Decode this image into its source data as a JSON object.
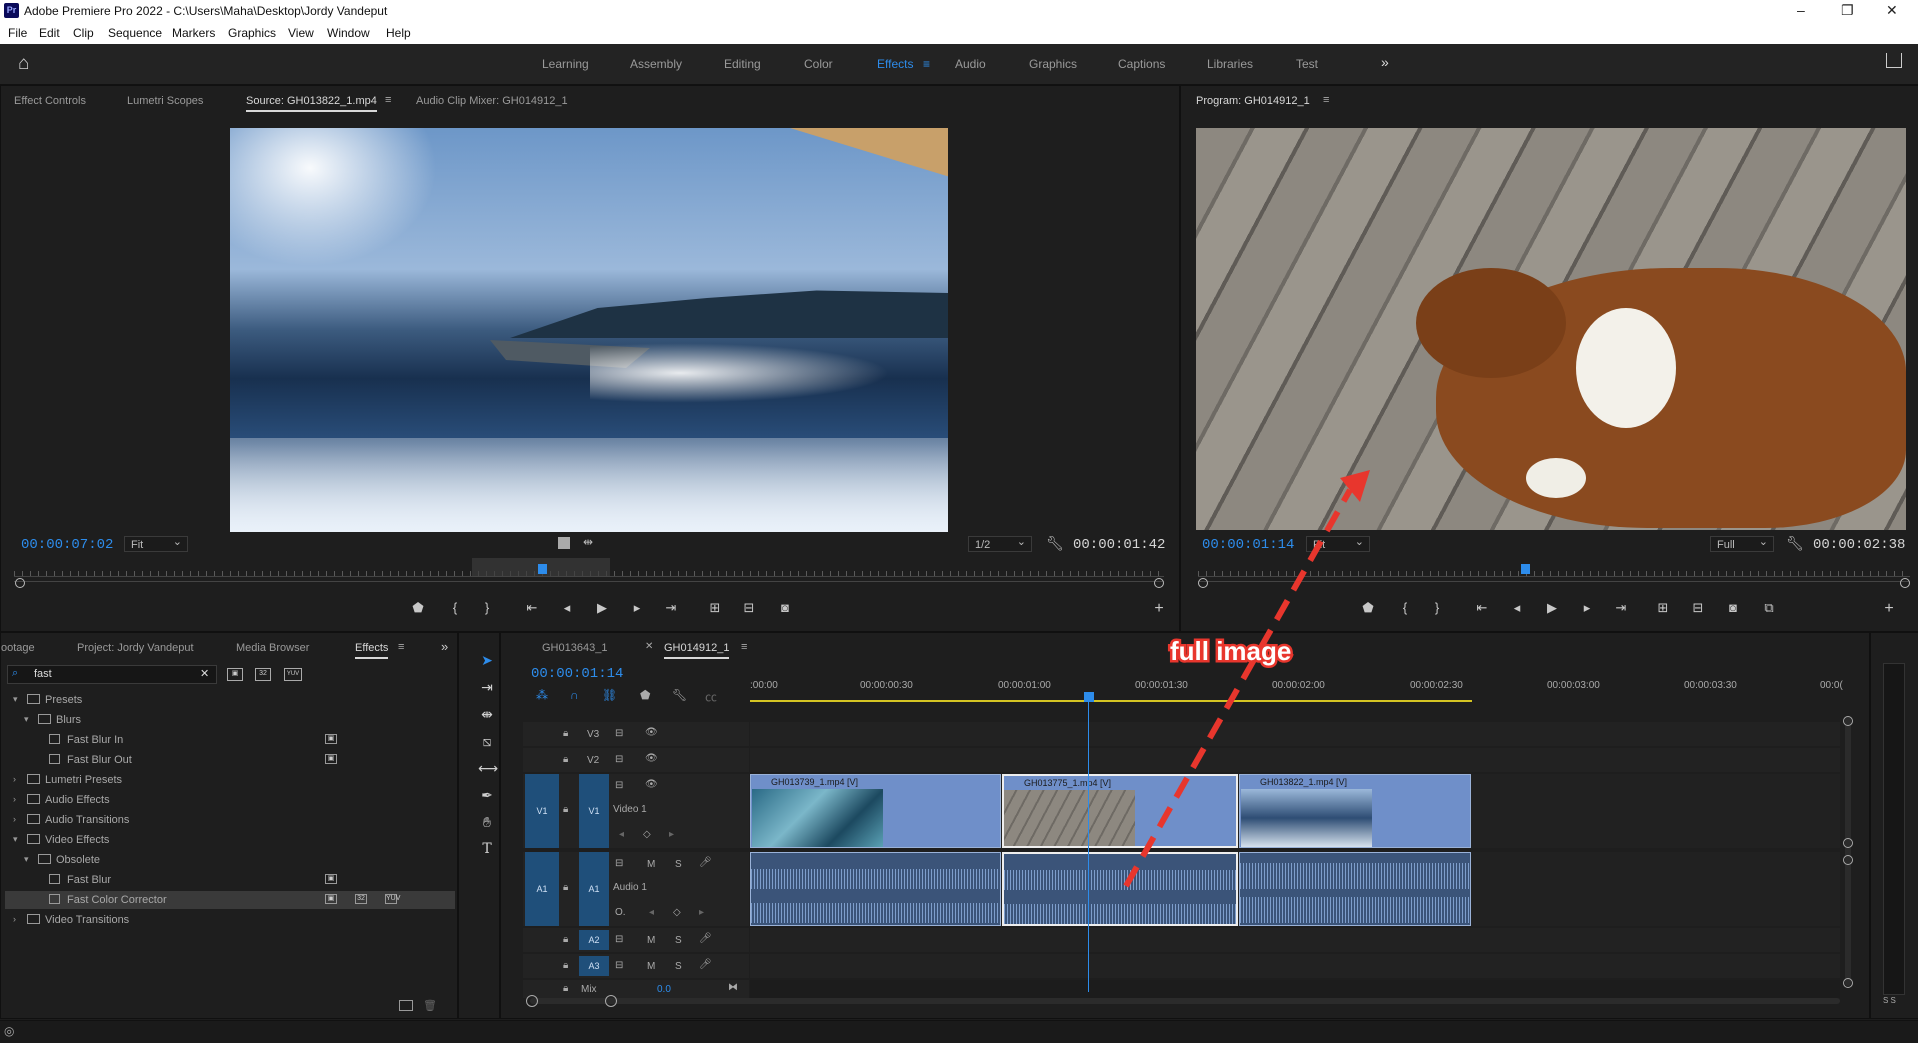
{
  "titlebar": {
    "logo": "Pr",
    "title": "Adobe Premiere Pro 2022 - C:\\Users\\Maha\\Desktop\\Jordy Vandeput",
    "minimize": "–",
    "restore": "❐",
    "close": "✕"
  },
  "menu": [
    "File",
    "Edit",
    "Clip",
    "Sequence",
    "Markers",
    "Graphics",
    "View",
    "Window",
    "Help"
  ],
  "workspaces": {
    "items": [
      "Learning",
      "Assembly",
      "Editing",
      "Color",
      "Effects",
      "Audio",
      "Graphics",
      "Captions",
      "Libraries",
      "Test"
    ],
    "active": "Effects",
    "more": "»"
  },
  "source_panel": {
    "tabs": [
      "Effect Controls",
      "Lumetri Scopes",
      "Source: GH013822_1.mp4",
      "Audio Clip Mixer: GH014912_1"
    ],
    "active_tab": "Source: GH013822_1.mp4",
    "timecode_in": "00:00:07:02",
    "fit": "Fit",
    "resolution": "1/2",
    "duration": "00:00:01:42"
  },
  "program_panel": {
    "tab": "Program: GH014912_1",
    "timecode": "00:00:01:14",
    "fit": "Fit",
    "resolution": "Full",
    "duration": "00:00:02:38"
  },
  "project_panel": {
    "tabs": [
      "ootage",
      "Project: Jordy Vandeput",
      "Media Browser",
      "Effects"
    ],
    "active_tab": "Effects",
    "search_value": "fast",
    "tree": [
      {
        "label": "Presets",
        "level": 0,
        "arrow": "▾",
        "folder": true
      },
      {
        "label": "Blurs",
        "level": 1,
        "arrow": "▾",
        "folder": true
      },
      {
        "label": "Fast Blur In",
        "level": 2,
        "arrow": "",
        "folder": false,
        "badges": [
          "▣"
        ]
      },
      {
        "label": "Fast Blur Out",
        "level": 2,
        "arrow": "",
        "folder": false,
        "badges": [
          "▣"
        ]
      },
      {
        "label": "Lumetri Presets",
        "level": 0,
        "arrow": "›",
        "folder": true
      },
      {
        "label": "Audio Effects",
        "level": 0,
        "arrow": "›",
        "folder": true
      },
      {
        "label": "Audio Transitions",
        "level": 0,
        "arrow": "›",
        "folder": true
      },
      {
        "label": "Video Effects",
        "level": 0,
        "arrow": "▾",
        "folder": true
      },
      {
        "label": "Obsolete",
        "level": 1,
        "arrow": "▾",
        "folder": true
      },
      {
        "label": "Fast Blur",
        "level": 2,
        "arrow": "",
        "folder": false,
        "badges": [
          "▣"
        ]
      },
      {
        "label": "Fast Color Corrector",
        "level": 2,
        "arrow": "",
        "folder": false,
        "badges": [
          "▣",
          "32",
          "YUV"
        ],
        "selected": true
      },
      {
        "label": "Video Transitions",
        "level": 0,
        "arrow": "›",
        "folder": true
      }
    ]
  },
  "timeline": {
    "tabs": [
      "GH013643_1",
      "GH014912_1"
    ],
    "active_tab": "GH014912_1",
    "timecode": "00:00:01:14",
    "ruler": [
      ":00:00",
      "00:00:00:30",
      "00:00:01:00",
      "00:00:01:30",
      "00:00:02:00",
      "00:00:02:30",
      "00:00:03:00",
      "00:00:03:30",
      "00:0("
    ],
    "tracks": {
      "v3": "V3",
      "v2": "V2",
      "v1": "V1",
      "v1_src": "V1",
      "video1": "Video 1",
      "a1": "A1",
      "a1_src": "A1",
      "audio1": "Audio 1",
      "a2": "A2",
      "a3": "A3",
      "mix": "Mix",
      "mix_value": "0.0",
      "m": "M",
      "s": "S"
    },
    "clips": [
      {
        "name": "GH013739_1.mp4 [V]",
        "thumb": "#3a6f8a"
      },
      {
        "name": "GH013775_1.mp4 [V]",
        "thumb": "#6b4a2c"
      },
      {
        "name": "GH013822_1.mp4 [V]",
        "thumb": "#7d9bc0"
      }
    ]
  },
  "annotation": {
    "text": "full image",
    "color": "#e8362d"
  }
}
